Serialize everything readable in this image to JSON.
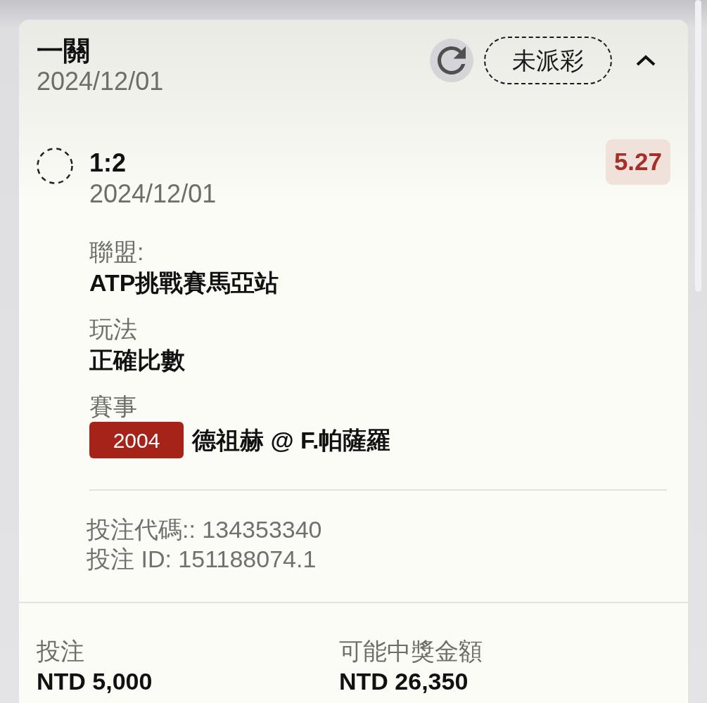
{
  "bet": {
    "title": "一關",
    "date": "2024/12/01",
    "status": {
      "label": "未派彩",
      "kind": "pending"
    },
    "expanded": true
  },
  "selections": [
    {
      "settled": false,
      "pick": "1:2",
      "date": "2024/12/01",
      "odds": "5.27",
      "fields": [
        {
          "kind": "text",
          "label": "聯盟:",
          "value": "ATP挑戰賽馬亞站"
        },
        {
          "kind": "text",
          "label": "玩法",
          "value": "正確比數"
        },
        {
          "kind": "match",
          "label": "賽事",
          "match_code": "2004",
          "value": "德祖赫 @ F.帕薩羅"
        }
      ],
      "bet_code": "投注代碼:: 134353340",
      "bet_id": "投注 ID: 151188074.1"
    }
  ],
  "summary": [
    {
      "label": "投注",
      "value": "NTD 5,000"
    },
    {
      "label": "可能中獎金額",
      "value": "NTD 26,350"
    }
  ]
}
